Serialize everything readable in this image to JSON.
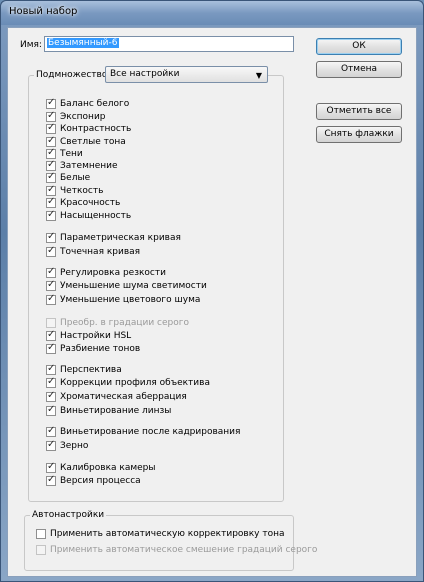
{
  "window": {
    "title": "Новый набор"
  },
  "form": {
    "name_label": "Имя:",
    "name_value": "Безымянный-6",
    "subset_label": "Подмножество:",
    "subset_value": "Все настройки"
  },
  "buttons": {
    "ok": "ОК",
    "cancel": "Отмена",
    "check_all": "Отметить все",
    "uncheck_all": "Снять флажки"
  },
  "checkboxes": [
    {
      "label": "Баланс белого",
      "checked": true,
      "disabled": false
    },
    {
      "label": "Экспонир",
      "checked": true,
      "disabled": false
    },
    {
      "label": "Контрастность",
      "checked": true,
      "disabled": false
    },
    {
      "label": "Светлые тона",
      "checked": true,
      "disabled": false
    },
    {
      "label": "Тени",
      "checked": true,
      "disabled": false
    },
    {
      "label": "Затемнение",
      "checked": true,
      "disabled": false
    },
    {
      "label": "Белые",
      "checked": true,
      "disabled": false
    },
    {
      "label": "Четкость",
      "checked": true,
      "disabled": false
    },
    {
      "label": "Красочность",
      "checked": true,
      "disabled": false
    },
    {
      "label": "Насыщенность",
      "checked": true,
      "disabled": false
    },
    {
      "label": "Параметрическая кривая",
      "checked": true,
      "disabled": false
    },
    {
      "label": "Точечная кривая",
      "checked": true,
      "disabled": false
    },
    {
      "label": "Регулировка резкости",
      "checked": true,
      "disabled": false
    },
    {
      "label": "Уменьшение шума светимости",
      "checked": true,
      "disabled": false
    },
    {
      "label": "Уменьшение цветового шума",
      "checked": true,
      "disabled": false
    },
    {
      "label": "Преобр. в градации серого",
      "checked": false,
      "disabled": true
    },
    {
      "label": "Настройки HSL",
      "checked": true,
      "disabled": false
    },
    {
      "label": "Разбиение тонов",
      "checked": true,
      "disabled": false
    },
    {
      "label": "Перспектива",
      "checked": true,
      "disabled": false
    },
    {
      "label": "Коррекции профиля объектива",
      "checked": true,
      "disabled": false
    },
    {
      "label": "Хроматическая аберрация",
      "checked": true,
      "disabled": false
    },
    {
      "label": "Виньетирование линзы",
      "checked": true,
      "disabled": false
    },
    {
      "label": "Виньетирование после кадрирования",
      "checked": true,
      "disabled": false
    },
    {
      "label": "Зерно",
      "checked": true,
      "disabled": false
    },
    {
      "label": "Калибровка камеры",
      "checked": true,
      "disabled": false
    },
    {
      "label": "Версия процесса",
      "checked": true,
      "disabled": false
    }
  ],
  "auto": {
    "group_label": "Автонастройки",
    "options": [
      {
        "label": "Применить автоматическую корректировку тона",
        "checked": false,
        "disabled": false
      },
      {
        "label": "Применить автоматическое смешение градаций серого",
        "checked": false,
        "disabled": true
      }
    ]
  }
}
